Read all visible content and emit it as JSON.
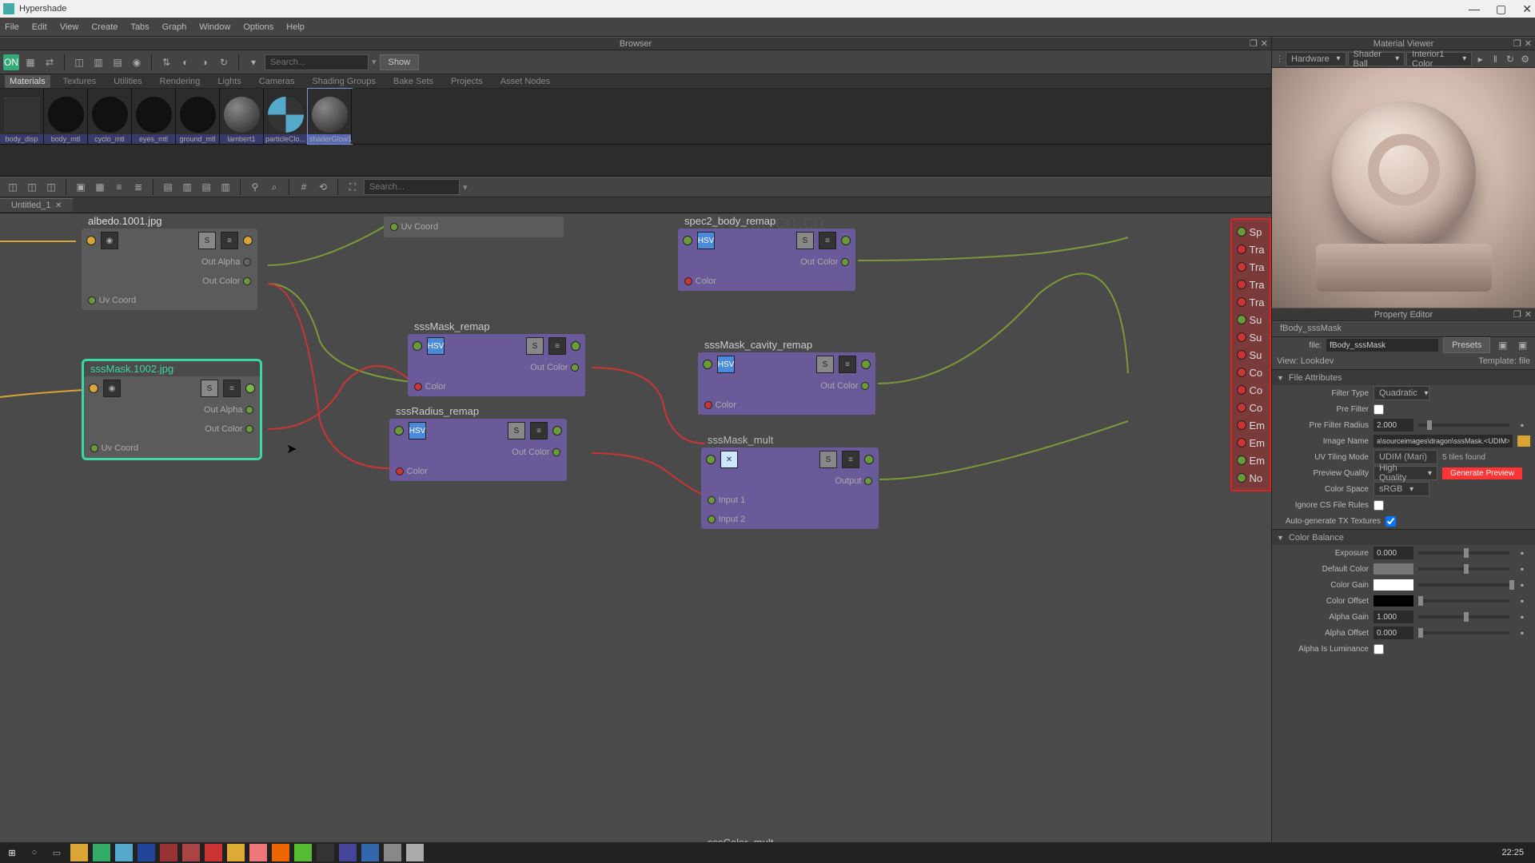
{
  "window": {
    "title": "Hypershade"
  },
  "menubar": [
    "File",
    "Edit",
    "View",
    "Create",
    "Tabs",
    "Graph",
    "Window",
    "Options",
    "Help"
  ],
  "browser": {
    "title": "Browser",
    "search_placeholder": "Search...",
    "show_label": "Show",
    "tabs": [
      "Materials",
      "Textures",
      "Utilities",
      "Rendering",
      "Lights",
      "Cameras",
      "Shading Groups",
      "Bake Sets",
      "Projects",
      "Asset Nodes"
    ],
    "swatches": [
      "body_disp",
      "body_mtl",
      "cyclo_mtl",
      "eyes_mtl",
      "ground_mtl",
      "lambert1",
      "particleClo...",
      "shaderGlow1"
    ]
  },
  "doc_tab": "Untitled_1",
  "graph": {
    "search_placeholder": "Search...",
    "nodes": {
      "albedo": {
        "title": "albedo.1001.jpg",
        "ports_r": [
          "Out Alpha",
          "Out Color"
        ],
        "ports_l": [
          "Uv Coord"
        ]
      },
      "sssmask": {
        "title": "sssMask.1002.jpg",
        "ports_r": [
          "Out Alpha",
          "Out Color"
        ],
        "ports_l": [
          "Uv Coord"
        ]
      },
      "uvcoord": {
        "label": "Uv Coord"
      },
      "sssmask_remap": {
        "title": "sssMask_remap",
        "out": "Out Color",
        "in": "Color"
      },
      "sssradius_remap": {
        "title": "sssRadius_remap",
        "out": "Out Color",
        "in": "Color"
      },
      "spec2": {
        "title": "spec2_body_remap",
        "out": "Out Color",
        "in": "Color"
      },
      "cavity": {
        "title": "sssMask_cavity_remap",
        "out": "Out Color",
        "in": "Color"
      },
      "mult": {
        "title": "sssMask_mult",
        "out": "Output",
        "in1": "Input 1",
        "in2": "Input 2"
      },
      "sssColor": {
        "title": "sssColor_mult"
      },
      "out_ports": [
        "Sp",
        "Tra",
        "Tra",
        "Tra",
        "Tra",
        "Su",
        "Su",
        "Su",
        "Co",
        "Co",
        "Co",
        "Em",
        "Em",
        "Em",
        "No"
      ]
    }
  },
  "material_viewer": {
    "title": "Material Viewer",
    "mode": "Hardware",
    "preview": "Shader Ball",
    "env": "Interior1 Color"
  },
  "property_editor": {
    "title": "Property Editor",
    "node_name": "fBody_sssMask",
    "file_label": "file:",
    "file_value": "fBody_sssMask",
    "presets_label": "Presets",
    "view_label": "View:",
    "view_value": "Lookdev",
    "template_label": "Template: file",
    "sections": {
      "file_attrs": {
        "title": "File Attributes",
        "filter_type_label": "Filter Type",
        "filter_type_value": "Quadratic",
        "pre_filter_label": "Pre Filter",
        "pre_filter_radius_label": "Pre Filter Radius",
        "pre_filter_radius_value": "2.000",
        "image_name_label": "Image Name",
        "image_name_value": "a\\sourceimages\\dragon\\sssMask.<UDIM>.jpg",
        "uv_tiling_label": "UV Tiling Mode",
        "uv_tiling_value": "UDIM (Mari)",
        "tiles_found": "5 tiles found",
        "preview_quality_label": "Preview Quality",
        "preview_quality_value": "High Quality",
        "generate_preview": "Generate Preview",
        "color_space_label": "Color Space",
        "color_space_value": "sRGB",
        "ignore_rules_label": "Ignore CS File Rules",
        "autogen_label": "Auto-generate TX Textures"
      },
      "color_balance": {
        "title": "Color Balance",
        "exposure_label": "Exposure",
        "exposure_value": "0.000",
        "default_color_label": "Default Color",
        "color_gain_label": "Color Gain",
        "color_offset_label": "Color Offset",
        "alpha_gain_label": "Alpha Gain",
        "alpha_gain_value": "1.000",
        "alpha_offset_label": "Alpha Offset",
        "alpha_offset_value": "0.000",
        "alpha_lum_label": "Alpha Is Luminance"
      }
    }
  },
  "watermark_url": "www.rrcg.cn",
  "taskbar": {
    "clock": "22:25"
  }
}
